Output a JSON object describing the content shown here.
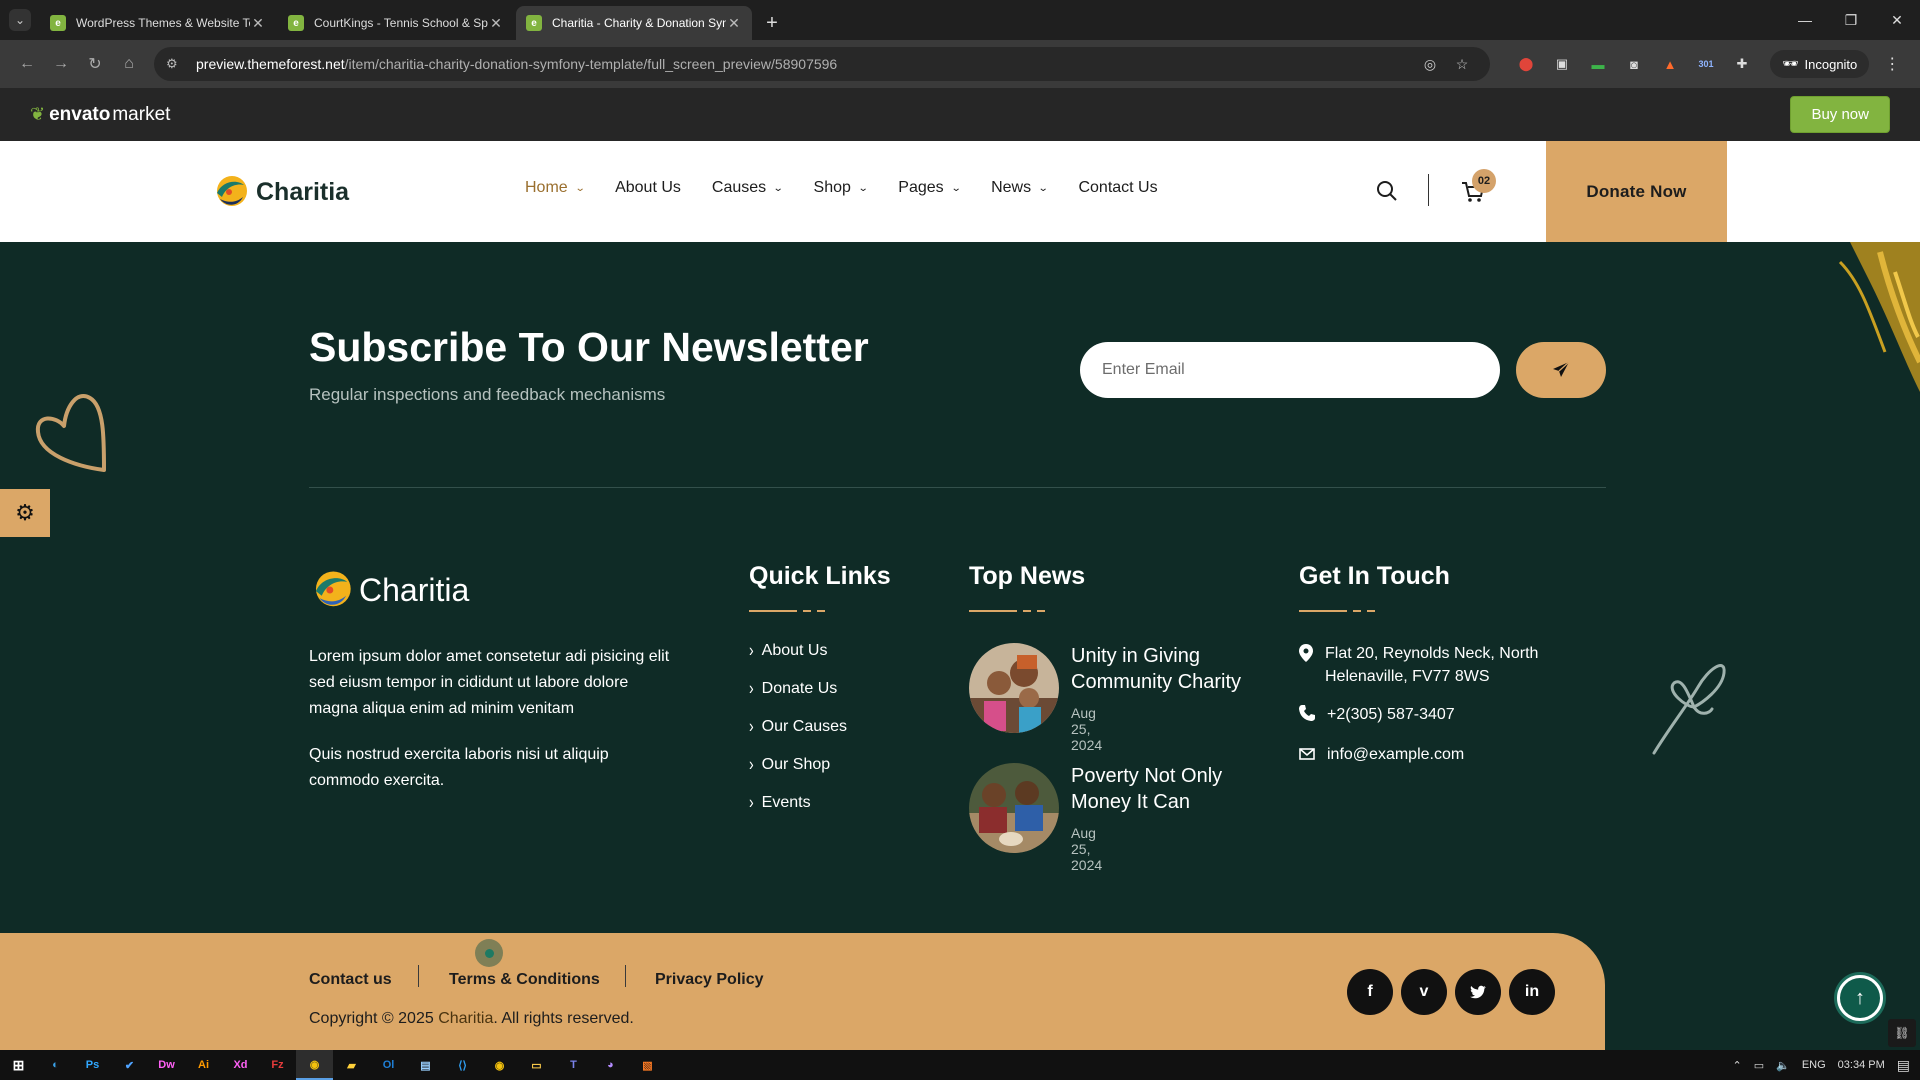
{
  "browser": {
    "tabs": [
      {
        "title": "WordPress Themes & Website Templates",
        "active": false
      },
      {
        "title": "CourtKings - Tennis School & Sports",
        "active": false
      },
      {
        "title": "Charitia - Charity & Donation Symfony",
        "active": true
      }
    ],
    "url_host": "preview.themeforest.net",
    "url_path": "/item/charitia-charity-donation-symfony-template/full_screen_preview/58907596",
    "incognito_label": "Incognito",
    "ext_badge": "301"
  },
  "envato": {
    "logo_bold": "envato",
    "logo_light": "market",
    "buy_label": "Buy now"
  },
  "header": {
    "brand": "Charitia",
    "nav": [
      {
        "label": "Home",
        "dropdown": true,
        "active": true
      },
      {
        "label": "About Us",
        "dropdown": false,
        "active": false
      },
      {
        "label": "Causes",
        "dropdown": true,
        "active": false
      },
      {
        "label": "Shop",
        "dropdown": true,
        "active": false
      },
      {
        "label": "Pages",
        "dropdown": true,
        "active": false
      },
      {
        "label": "News",
        "dropdown": true,
        "active": false
      },
      {
        "label": "Contact Us",
        "dropdown": false,
        "active": false
      }
    ],
    "cart_count": "02",
    "donate_label": "Donate Now"
  },
  "newsletter": {
    "title": "Subscribe To Our Newsletter",
    "subtitle": "Regular inspections and feedback mechanisms",
    "email_placeholder": "Enter Email"
  },
  "footer": {
    "brand": "Charitia",
    "about_1": "Lorem ipsum dolor amet consetetur adi pisicing elit sed eiusm tempor in cididunt ut labore dolore magna aliqua enim ad minim venitam",
    "about_2": "Quis nostrud exercita laboris nisi ut aliquip commodo exercita.",
    "quick_links_title": "Quick Links",
    "quick_links": [
      "About Us",
      "Donate Us",
      "Our Causes",
      "Our Shop",
      "Events"
    ],
    "top_news_title": "Top News",
    "news": [
      {
        "title": "Unity in Giving Community Charity",
        "date": "Aug 25, 2024"
      },
      {
        "title": "Poverty Not Only Money It Can",
        "date": "Aug 25, 2024"
      }
    ],
    "contact_title": "Get In Touch",
    "address": "Flat 20, Reynolds Neck, North Helenaville, FV77 8WS",
    "phone": "+2(305) 587-3407",
    "email": "info@example.com"
  },
  "bottom": {
    "links": [
      "Contact us",
      "Terms & Conditions",
      "Privacy Policy"
    ],
    "copyright_pre": "Copyright © 2025",
    "copyright_brand": "Charitia",
    "copyright_post": ". All rights reserved.",
    "socials": [
      "facebook-icon",
      "vimeo-icon",
      "twitter-icon",
      "linkedin-icon"
    ]
  },
  "taskbar": {
    "lang": "ENG",
    "time": "03:34 PM"
  },
  "colors": {
    "accent": "#dba767",
    "footer_bg": "#0f2b26",
    "envato_green": "#82b440"
  }
}
